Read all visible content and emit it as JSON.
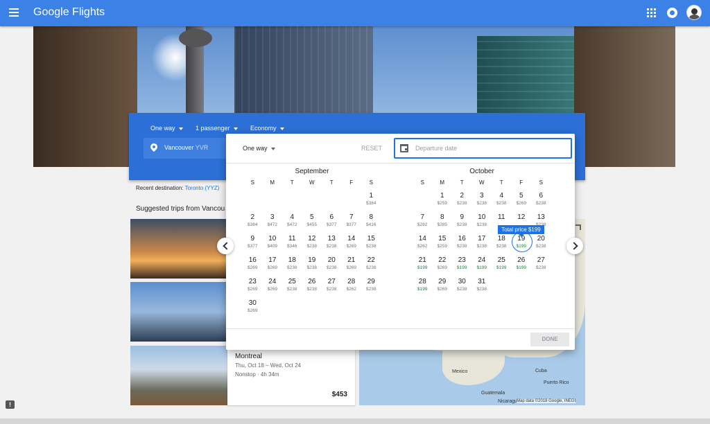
{
  "header": {
    "logo_brand": "Google",
    "logo_product": "Flights"
  },
  "search": {
    "trip_type": "One way",
    "passengers": "1 passenger",
    "cabin": "Economy",
    "origin_city": "Vancouver",
    "origin_code": "YVR"
  },
  "recent": {
    "label": "Recent destination:",
    "link": "Toronto (YYZ)"
  },
  "suggested": {
    "title": "Suggested trips from Vancou",
    "trip": {
      "city": "Montreal",
      "dates": "Thu, Oct 18 – Wed, Oct 24",
      "stops": "Nonstop · 4h 34m",
      "price": "$453"
    }
  },
  "map": {
    "label_mexico": "Mexico",
    "label_cuba": "Cuba",
    "label_puerto_rico": "Puerto Rico",
    "label_guatemala": "Guatemala",
    "label_nicaragua": "Nicaragua",
    "credit": "Map data ©2018 Google, INEGI"
  },
  "picker": {
    "trip_type": "One way",
    "reset": "RESET",
    "date_placeholder": "Departure date",
    "done": "DONE",
    "tooltip": "Total price $199",
    "weekdays": [
      "S",
      "M",
      "T",
      "W",
      "T",
      "F",
      "S"
    ],
    "months": [
      {
        "name": "September",
        "offset": 6,
        "days": [
          [
            "1",
            "$384"
          ],
          [
            "2",
            "$384"
          ],
          [
            "3",
            "$472"
          ],
          [
            "4",
            "$472"
          ],
          [
            "5",
            "$455"
          ],
          [
            "6",
            "$377"
          ],
          [
            "7",
            "$377"
          ],
          [
            "8",
            "$416"
          ],
          [
            "9",
            "$377"
          ],
          [
            "10",
            "$409"
          ],
          [
            "11",
            "$346"
          ],
          [
            "12",
            "$238"
          ],
          [
            "13",
            "$238"
          ],
          [
            "14",
            "$269"
          ],
          [
            "15",
            "$238"
          ],
          [
            "16",
            "$269"
          ],
          [
            "17",
            "$269"
          ],
          [
            "18",
            "$238"
          ],
          [
            "19",
            "$238"
          ],
          [
            "20",
            "$238"
          ],
          [
            "21",
            "$269"
          ],
          [
            "22",
            "$238"
          ],
          [
            "23",
            "$269"
          ],
          [
            "24",
            "$269"
          ],
          [
            "25",
            "$238"
          ],
          [
            "26",
            "$238"
          ],
          [
            "27",
            "$238"
          ],
          [
            "28",
            "$262"
          ],
          [
            "29",
            "$238"
          ],
          [
            "30",
            "$269"
          ]
        ]
      },
      {
        "name": "October",
        "offset": 1,
        "days": [
          [
            "1",
            "$259"
          ],
          [
            "2",
            "$238"
          ],
          [
            "3",
            "$238"
          ],
          [
            "4",
            "$238"
          ],
          [
            "5",
            "$269"
          ],
          [
            "6",
            "$238"
          ],
          [
            "7",
            "$262"
          ],
          [
            "8",
            "$285"
          ],
          [
            "9",
            "$238"
          ],
          [
            "10",
            "$238"
          ],
          [
            "11",
            ""
          ],
          [
            "12",
            ""
          ],
          [
            "13",
            "$238"
          ],
          [
            "14",
            "$262"
          ],
          [
            "15",
            "$259"
          ],
          [
            "16",
            "$238"
          ],
          [
            "17",
            "$238"
          ],
          [
            "18",
            "$238"
          ],
          [
            "19",
            "$199"
          ],
          [
            "20",
            "$238"
          ],
          [
            "21",
            "$199"
          ],
          [
            "22",
            "$269"
          ],
          [
            "23",
            "$199"
          ],
          [
            "24",
            "$199"
          ],
          [
            "25",
            "$199"
          ],
          [
            "26",
            "$199"
          ],
          [
            "27",
            "$238"
          ],
          [
            "28",
            "$199"
          ],
          [
            "29",
            "$269"
          ],
          [
            "30",
            "$238"
          ],
          [
            "31",
            "$238"
          ]
        ]
      }
    ],
    "selected": {
      "month": 1,
      "day": "19"
    },
    "low_price": "$199",
    "colors": {
      "accent": "#1a73e8",
      "low": "#188038",
      "header": "#3c82e6"
    }
  }
}
